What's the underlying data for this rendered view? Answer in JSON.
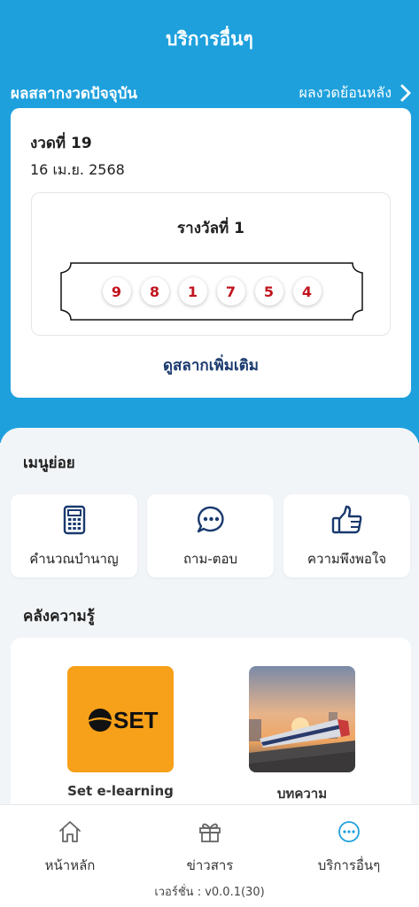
{
  "header": {
    "title": "บริการอื่นๆ"
  },
  "lottery": {
    "section_title": "ผลสลากงวดปัจจุบัน",
    "history_link": "ผลงวดย้อนหลัง",
    "draw_label": "งวดที่ 19",
    "draw_date": "16 เม.ย. 2568",
    "prize_title": "รางวัลที่ 1",
    "numbers": [
      "9",
      "8",
      "1",
      "7",
      "5",
      "4"
    ],
    "more_link": "ดูสลากเพิ่มเติม"
  },
  "submenu": {
    "title": "เมนูย่อย",
    "items": [
      {
        "label": "คำนวณบำนาญ",
        "icon": "calculator-icon"
      },
      {
        "label": "ถาม-ตอบ",
        "icon": "chat-bubble-icon"
      },
      {
        "label": "ความพึงพอใจ",
        "icon": "thumbs-up-icon"
      }
    ]
  },
  "knowledge": {
    "title": "คลังความรู้",
    "items": [
      {
        "label": "Set e-learning",
        "logo_text": "SET",
        "icon": "set-logo"
      },
      {
        "label": "บทความ",
        "icon": "train-photo"
      }
    ]
  },
  "bottom_nav": {
    "items": [
      {
        "label": "หน้าหลัก",
        "icon": "home-icon"
      },
      {
        "label": "ข่าวสาร",
        "icon": "gift-icon"
      },
      {
        "label": "บริการอื่นๆ",
        "icon": "more-icon",
        "active": true
      }
    ]
  },
  "version": "เวอร์ชั่น : v0.0.1(30)",
  "colors": {
    "primary": "#1ea0dd",
    "navy": "#1a3a6e",
    "number_red": "#c0141f",
    "set_orange": "#f7a019",
    "active_icon": "#1ea0dd"
  }
}
